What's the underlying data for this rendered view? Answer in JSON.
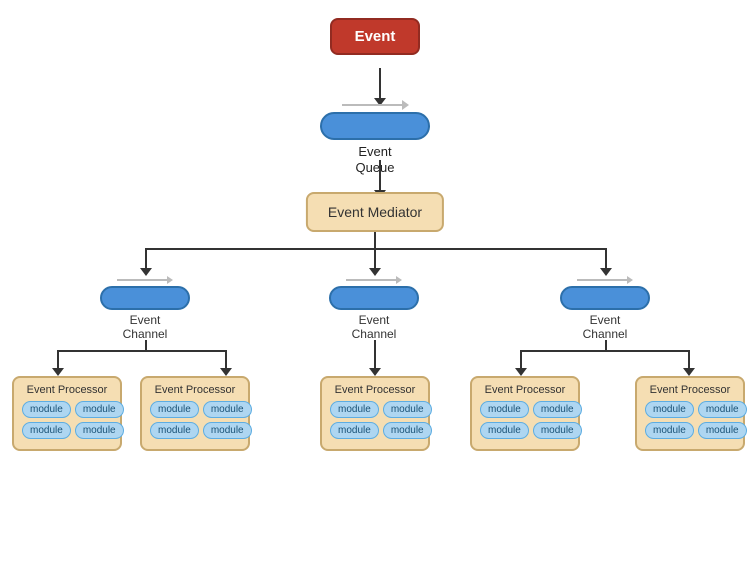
{
  "event": {
    "label": "Event"
  },
  "queue": {
    "label": "Event\nQueue"
  },
  "mediator": {
    "label": "Event Mediator"
  },
  "channels": [
    {
      "label": "Event\nChannel"
    },
    {
      "label": "Event\nChannel"
    },
    {
      "label": "Event\nChannel"
    }
  ],
  "processors": [
    {
      "title": "Event Processor",
      "modules": [
        "module",
        "module",
        "module",
        "module"
      ]
    },
    {
      "title": "Event Processor",
      "modules": [
        "module",
        "module",
        "module",
        "module"
      ]
    },
    {
      "title": "Event Processor",
      "modules": [
        "module",
        "module",
        "module",
        "module"
      ]
    },
    {
      "title": "Event Processor",
      "modules": [
        "module",
        "module",
        "module",
        "module"
      ]
    },
    {
      "title": "Event Processor",
      "modules": [
        "module",
        "module",
        "module",
        "module"
      ]
    }
  ]
}
